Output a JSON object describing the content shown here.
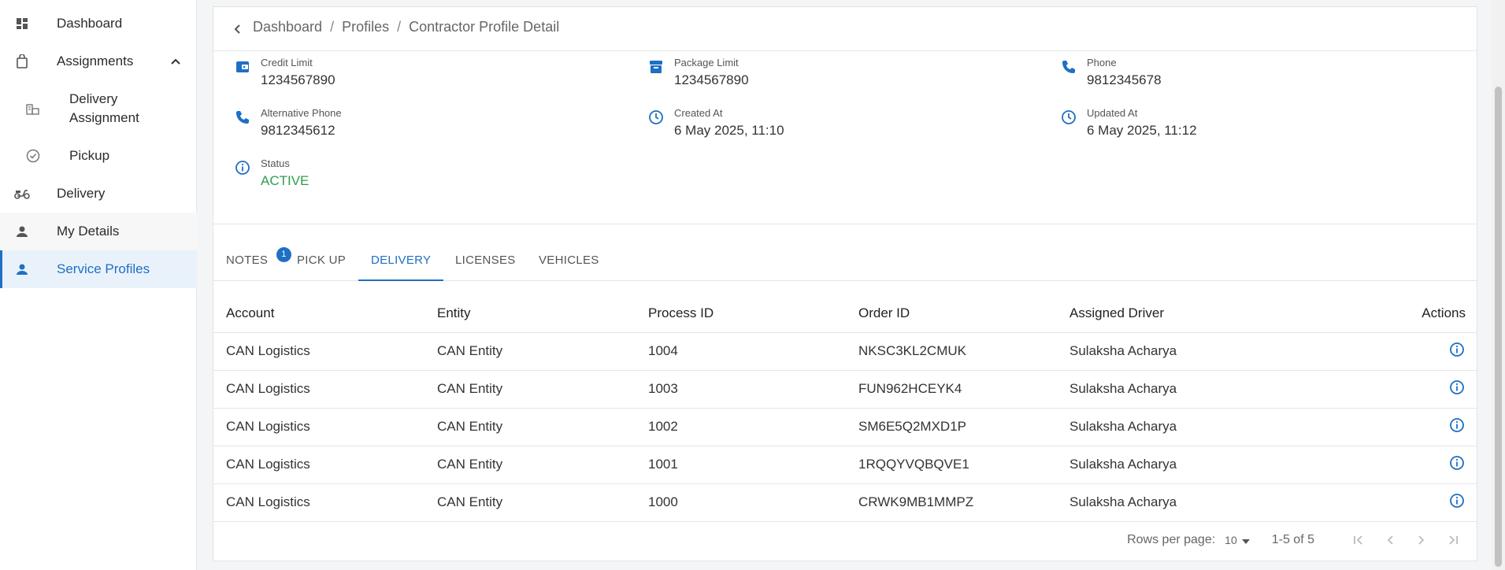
{
  "sidebar": {
    "items": [
      {
        "label": "Dashboard",
        "icon": "dashboard-icon"
      },
      {
        "label": "Assignments",
        "icon": "bag-icon"
      },
      {
        "label": "Delivery\nAssignment",
        "icon": "delivery-assignment-icon"
      },
      {
        "label": "Pickup",
        "icon": "check-circle-icon"
      },
      {
        "label": "Delivery",
        "icon": "scooter-icon"
      },
      {
        "label": "My Details",
        "icon": "person-icon"
      },
      {
        "label": "Service Profiles",
        "icon": "person-icon"
      }
    ]
  },
  "breadcrumb": {
    "items": [
      "Dashboard",
      "Profiles",
      "Contractor Profile Detail"
    ],
    "separator": "/"
  },
  "details": {
    "credit_limit": {
      "label": "Credit Limit",
      "value": "1234567890"
    },
    "package_limit": {
      "label": "Package Limit",
      "value": "1234567890"
    },
    "phone": {
      "label": "Phone",
      "value": "9812345678"
    },
    "alt_phone": {
      "label": "Alternative Phone",
      "value": "9812345612"
    },
    "created_at": {
      "label": "Created At",
      "value": "6 May 2025, 11:10"
    },
    "updated_at": {
      "label": "Updated At",
      "value": "6 May 2025, 11:12"
    },
    "status": {
      "label": "Status",
      "value": "ACTIVE"
    }
  },
  "tabs": {
    "items": [
      "NOTES",
      "PICK UP",
      "DELIVERY",
      "LICENSES",
      "VEHICLES"
    ],
    "active": "DELIVERY",
    "notes_badge": "1"
  },
  "table": {
    "headers": [
      "Account",
      "Entity",
      "Process ID",
      "Order ID",
      "Assigned Driver",
      "Actions"
    ],
    "rows": [
      [
        "CAN Logistics",
        "CAN Entity",
        "1004",
        "NKSC3KL2CMUK",
        "Sulaksha Acharya"
      ],
      [
        "CAN Logistics",
        "CAN Entity",
        "1003",
        "FUN962HCEYK4",
        "Sulaksha Acharya"
      ],
      [
        "CAN Logistics",
        "CAN Entity",
        "1002",
        "SM6E5Q2MXD1P",
        "Sulaksha Acharya"
      ],
      [
        "CAN Logistics",
        "CAN Entity",
        "1001",
        "1RQQYVQBQVE1",
        "Sulaksha Acharya"
      ],
      [
        "CAN Logistics",
        "CAN Entity",
        "1000",
        "CRWK9MB1MMPZ",
        "Sulaksha Acharya"
      ]
    ]
  },
  "pagination": {
    "rows_per_page_label": "Rows per page:",
    "rows_per_page": "10",
    "range": "1-5 of 5"
  },
  "colors": {
    "accent": "#1f6fc4",
    "status_active": "#2e9e4f"
  }
}
